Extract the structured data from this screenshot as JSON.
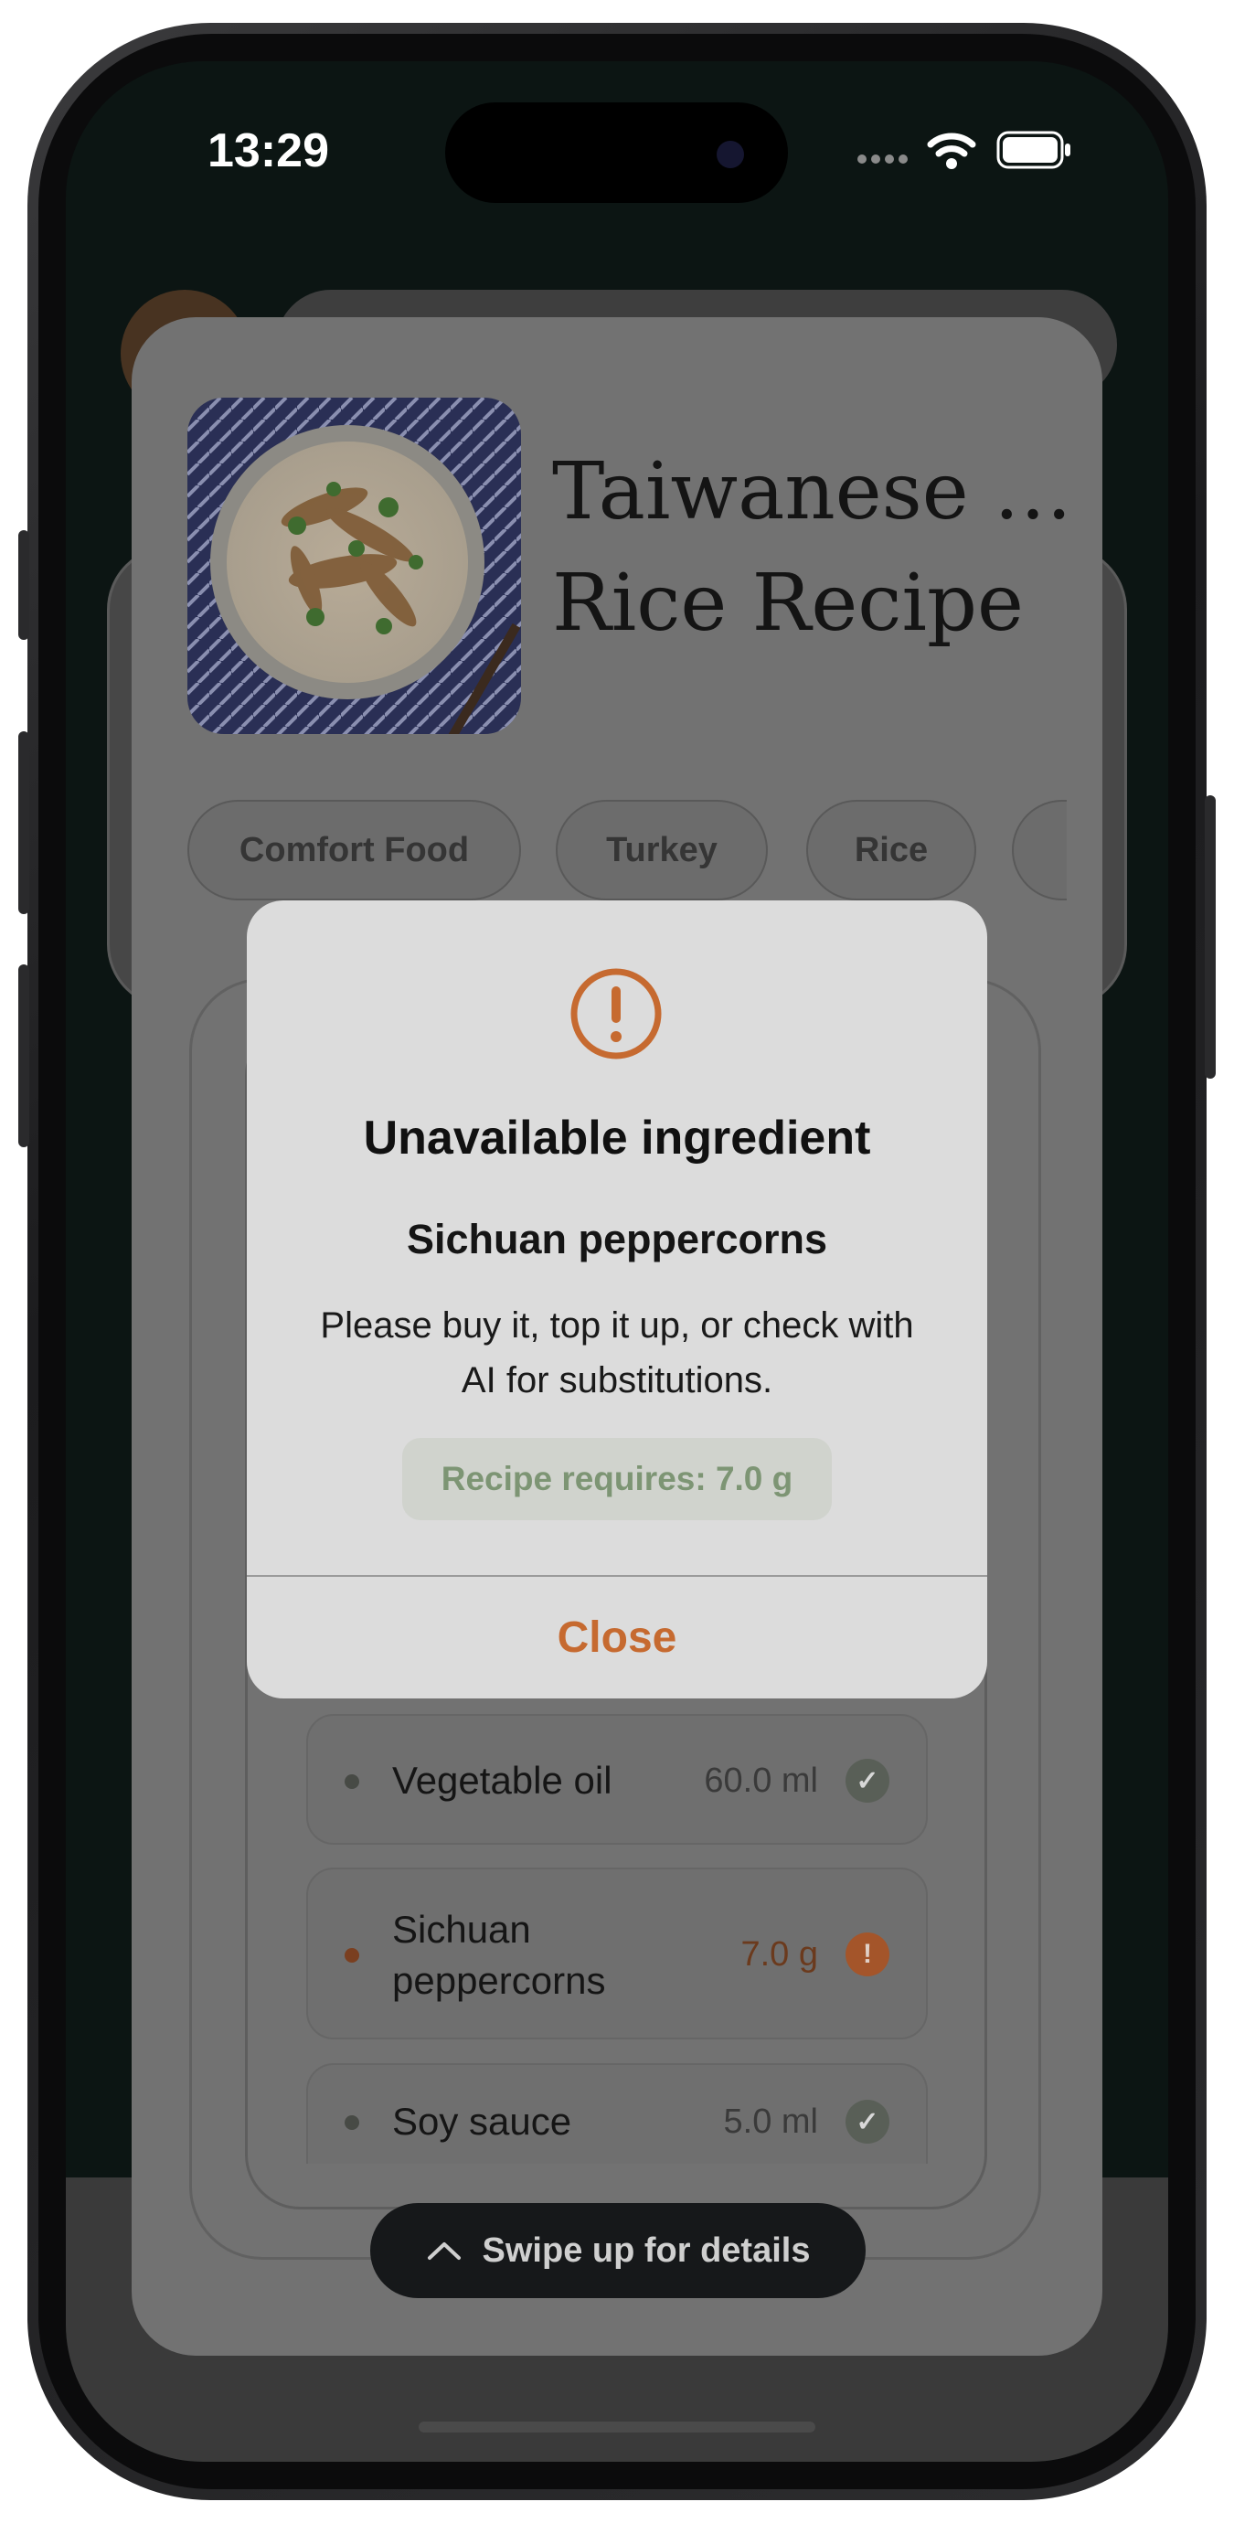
{
  "status_bar": {
    "time": "13:29"
  },
  "recipe": {
    "title_line1": "Taiwanese …",
    "title_line2": "Rice Recipe",
    "image_alt": "bowl of shredded turkey rice",
    "tags": [
      "Comfort Food",
      "Turkey",
      "Rice"
    ]
  },
  "ingredients": [
    {
      "name": "Vegetable oil",
      "quantity": "60.0 ml",
      "status": "available",
      "dot_color": "#474a45",
      "icon": "check-icon"
    },
    {
      "name": "Sichuan peppercorns",
      "quantity": "7.0 g",
      "status": "unavailable",
      "dot_color": "#7a3f20",
      "icon": "exclamation-icon"
    },
    {
      "name": "Soy sauce",
      "quantity": "5.0 ml",
      "status": "available",
      "dot_color": "#474a45",
      "icon": "check-icon"
    }
  ],
  "swipe_hint": {
    "label": "Swipe up for details",
    "icon": "chevron-up-icon"
  },
  "dialog": {
    "icon": "warning-circle-icon",
    "title": "Unavailable ingredient",
    "ingredient": "Sichuan peppercorns",
    "message": "Please buy it, top it up, or check with AI for substitutions.",
    "requirement": "Recipe requires: 7.0 g",
    "close_label": "Close"
  },
  "colors": {
    "accent": "#c66a30",
    "requirement_text": "#7d9574",
    "dialog_bg": "#dcdcdc",
    "check_icon_bg": "#595f57",
    "warning_icon_bg": "#a4552a"
  }
}
